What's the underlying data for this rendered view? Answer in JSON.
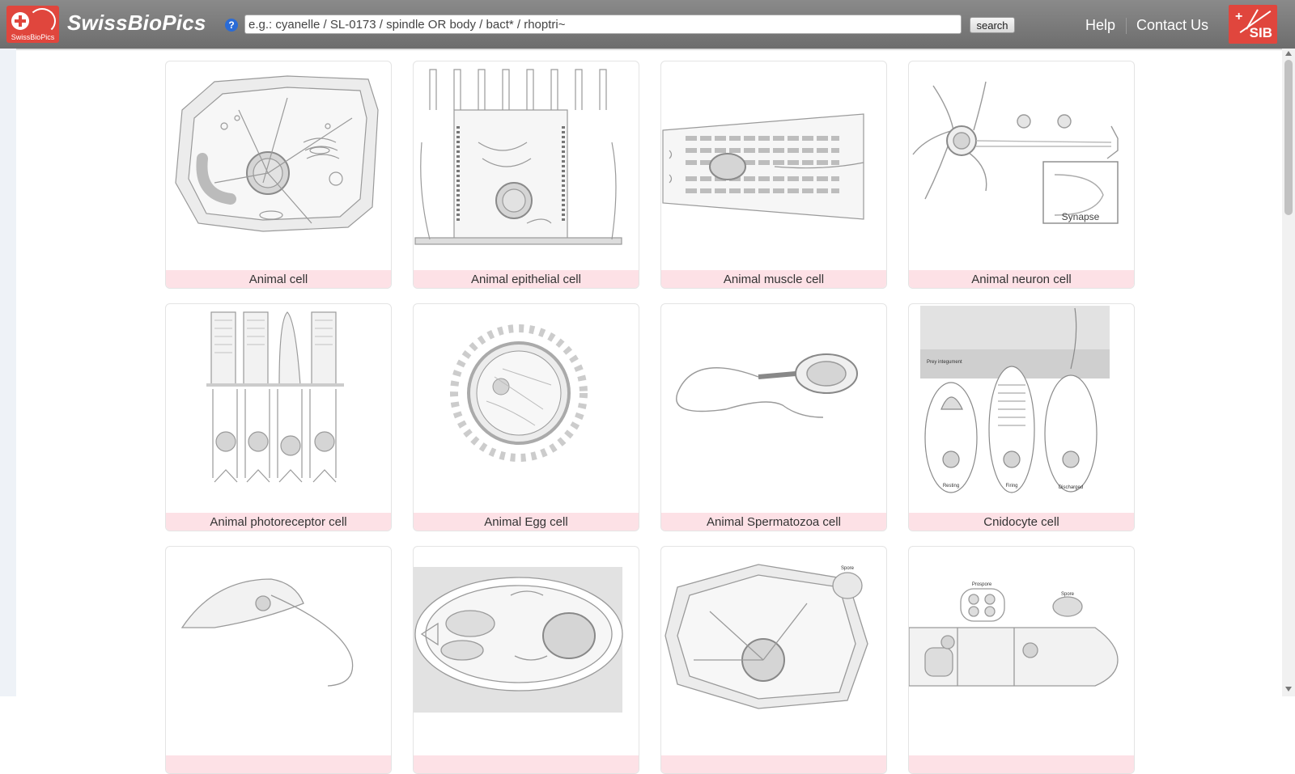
{
  "header": {
    "logo_text": "SwissBioPics",
    "brand": "SwissBioPics",
    "help_icon_glyph": "?",
    "search_placeholder": "e.g.: cyanelle / SL-0173 / spindle OR body / bact* / rhoptri~",
    "search_button": "search",
    "nav": {
      "help": "Help",
      "contact": "Contact Us"
    },
    "sib_logo_text": "SIB"
  },
  "colors": {
    "header_bg": "#7a7a7a",
    "brand_red": "#e0463d",
    "caption_bg": "#fde1e6",
    "help_icon": "#2a6bd6"
  },
  "cells": [
    {
      "label": "Animal cell",
      "icon": "animal-cell-illustration"
    },
    {
      "label": "Animal epithelial cell",
      "icon": "epithelial-cell-illustration"
    },
    {
      "label": "Animal muscle cell",
      "icon": "muscle-cell-illustration"
    },
    {
      "label": "Animal neuron cell",
      "icon": "neuron-cell-illustration",
      "inset_label": "Synapse"
    },
    {
      "label": "Animal photoreceptor cell",
      "icon": "photoreceptor-cell-illustration"
    },
    {
      "label": "Animal Egg cell",
      "icon": "egg-cell-illustration"
    },
    {
      "label": "Animal Spermatozoa cell",
      "icon": "spermatozoa-illustration"
    },
    {
      "label": "Cnidocyte cell",
      "icon": "cnidocyte-illustration",
      "annotations": {
        "prey": "Prey integument",
        "resting": "Resting",
        "firing": "Firing",
        "discharged": "Discharged"
      }
    },
    {
      "label": "",
      "icon": "trypanosome-illustration"
    },
    {
      "label": "",
      "icon": "oval-cell-illustration"
    },
    {
      "label": "",
      "icon": "spore-cell-illustration",
      "annotations": {
        "spore": "Spore"
      }
    },
    {
      "label": "",
      "icon": "sporulating-cell-illustration",
      "annotations": {
        "prospore": "Prospore",
        "spore": "Spore"
      }
    }
  ]
}
